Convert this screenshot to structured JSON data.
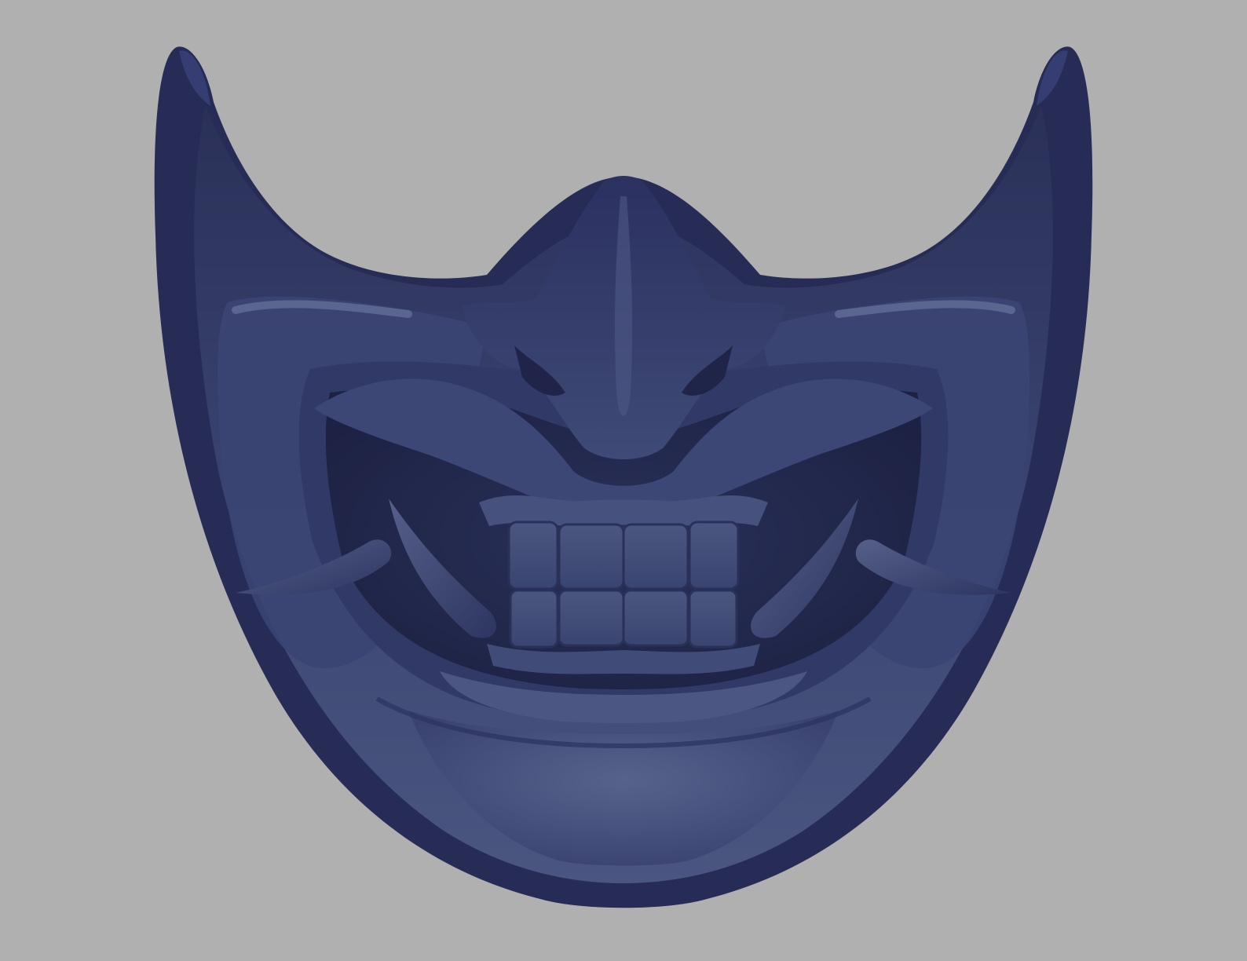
{
  "scene": {
    "subject": "mask-render",
    "colors": {
      "background": "#b0b0b0",
      "mask_dark": "#23294f",
      "mask_mid": "#343d68",
      "mask_light": "#4a5580",
      "mask_highlight": "#5c6890"
    }
  }
}
